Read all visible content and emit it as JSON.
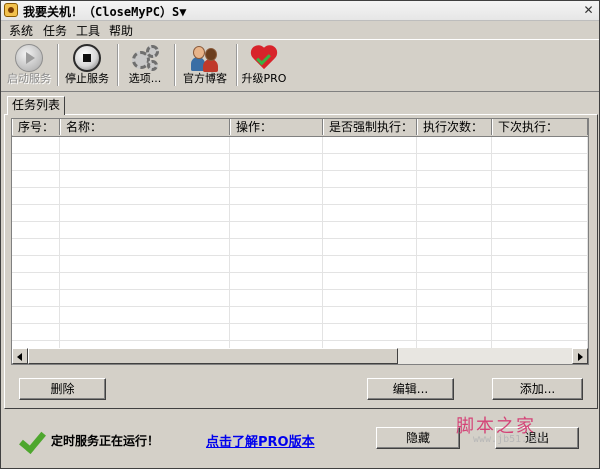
{
  "window": {
    "title": "我要关机！（CloseMyPC）S▼",
    "close_glyph": "✕"
  },
  "menu": [
    "系统",
    "任务",
    "工具",
    "帮助"
  ],
  "toolbar": [
    {
      "label": "启动服务",
      "icon": "play-icon",
      "enabled": false
    },
    {
      "label": "停止服务",
      "icon": "stop-icon",
      "enabled": true
    },
    {
      "label": "选项...",
      "icon": "gears-icon",
      "enabled": true
    },
    {
      "label": "官方博客",
      "icon": "people-icon",
      "enabled": true
    },
    {
      "label": "升级PRO",
      "icon": "heart-icon",
      "enabled": true
    }
  ],
  "tabs": [
    {
      "label": "任务列表",
      "active": true
    }
  ],
  "task_list": {
    "columns": [
      "序号：",
      "名称：",
      "操作：",
      "是否强制执行：",
      "执行次数：",
      "下次执行："
    ],
    "rows": []
  },
  "buttons": {
    "delete": "删除",
    "edit": "编辑...",
    "add": "添加...",
    "hide": "隐藏",
    "exit": "退出"
  },
  "status": {
    "text": "定时服务正在运行！",
    "pro_link": "点击了解PRO版本"
  },
  "watermark": {
    "text": "脚本之家",
    "url": "www.jb51.net"
  }
}
